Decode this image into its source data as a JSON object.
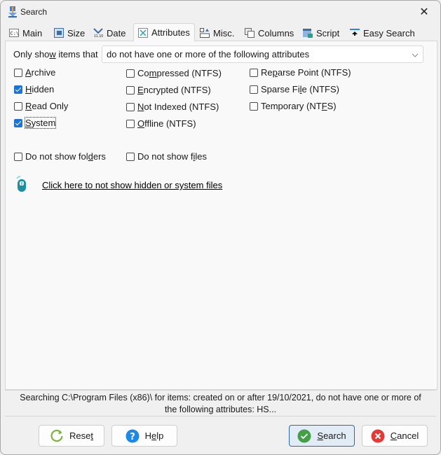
{
  "window": {
    "title": "Search",
    "close_glyph": "✕"
  },
  "tabs": [
    {
      "label": "Main",
      "icon": "drive-path-icon",
      "active": false
    },
    {
      "label": "Size",
      "icon": "size-icon",
      "active": false
    },
    {
      "label": "Date",
      "icon": "date-icon",
      "active": false
    },
    {
      "label": "Attributes",
      "icon": "attributes-icon",
      "active": true
    },
    {
      "label": "Misc.",
      "icon": "misc-icon",
      "active": false
    },
    {
      "label": "Columns",
      "icon": "columns-icon",
      "active": false
    },
    {
      "label": "Script",
      "icon": "script-icon",
      "active": false
    },
    {
      "label": "Easy Search",
      "icon": "easy-search-icon",
      "active": false
    }
  ],
  "filter": {
    "label_pre": "Only sho",
    "label_accel": "w",
    "label_post": " items that",
    "selected": "do not have one or more of the following attributes"
  },
  "attributes": {
    "col1": [
      {
        "pre": "",
        "accel": "A",
        "post": "rchive",
        "checked": false
      },
      {
        "pre": "",
        "accel": "H",
        "post": "idden",
        "checked": true
      },
      {
        "pre": "",
        "accel": "R",
        "post": "ead Only",
        "checked": false
      },
      {
        "pre": "",
        "accel": "S",
        "post": "ystem",
        "checked": true
      }
    ],
    "col2": [
      {
        "pre": "Co",
        "accel": "m",
        "post": "pressed (NTFS)",
        "checked": false
      },
      {
        "pre": "",
        "accel": "E",
        "post": "ncrypted (NTFS)",
        "checked": false
      },
      {
        "pre": "",
        "accel": "N",
        "post": "ot Indexed (NTFS)",
        "checked": false
      },
      {
        "pre": "",
        "accel": "O",
        "post": "ffline (NTFS)",
        "checked": false
      }
    ],
    "col3": [
      {
        "pre": "Re",
        "accel": "p",
        "post": "arse Point (NTFS)",
        "checked": false
      },
      {
        "pre": "Sparse Fi",
        "accel": "l",
        "post": "e (NTFS)",
        "checked": false
      },
      {
        "pre": "Temporary (NT",
        "accel": "F",
        "post": "S)",
        "checked": false
      }
    ]
  },
  "options": {
    "no_folders": {
      "pre": "Do not show fol",
      "accel": "d",
      "post": "ers",
      "checked": false
    },
    "no_files": {
      "pre": "Do not show f",
      "accel": "i",
      "post": "les",
      "checked": false
    }
  },
  "link": {
    "text": "Click here to not show hidden or system files"
  },
  "status": {
    "line1": "Searching C:\\Program Files (x86)\\ for items: created on or after 19/10/2021, do not have one or more of",
    "line2": "the following attributes: HS..."
  },
  "buttons": {
    "reset": {
      "pre": "Rese",
      "accel": "t",
      "post": ""
    },
    "help": {
      "pre": "H",
      "accel": "e",
      "post": "lp"
    },
    "search": {
      "pre": "",
      "accel": "S",
      "post": "earch"
    },
    "cancel": {
      "pre": "",
      "accel": "C",
      "post": "ancel"
    }
  },
  "colors": {
    "accent": "#1a73d8",
    "reset_icon": "#7cb342",
    "help_icon": "#1e88e5",
    "search_icon": "#43a047",
    "cancel_icon": "#e53935"
  }
}
